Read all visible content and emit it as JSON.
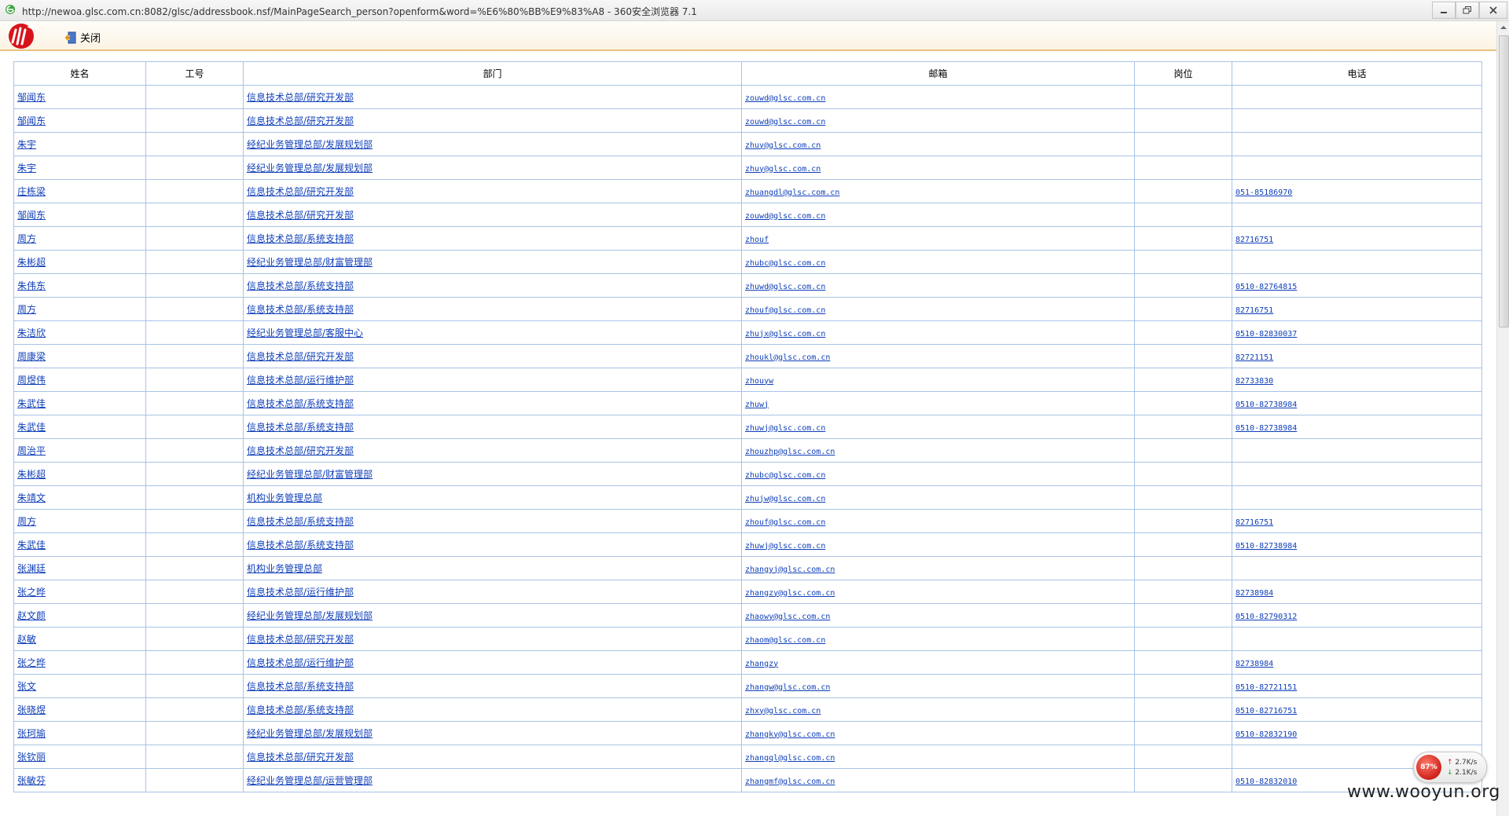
{
  "window": {
    "title": "http://newoa.glsc.com.cn:8082/glsc/addressbook.nsf/MainPageSearch_person?openform&word=%E6%80%BB%E9%83%A8 - 360安全浏览器 7.1"
  },
  "toolbar": {
    "close_label": "关闭"
  },
  "table": {
    "headers": [
      "姓名",
      "工号",
      "部门",
      "邮箱",
      "岗位",
      "电话"
    ],
    "rows": [
      {
        "name": "邹闻东",
        "id": "",
        "dept": "信息技术总部/研究开发部",
        "email": "zouwd@glsc.com.cn",
        "post": "",
        "phone": ""
      },
      {
        "name": "邹闻东",
        "id": "",
        "dept": "信息技术总部/研究开发部",
        "email": "zouwd@glsc.com.cn",
        "post": "",
        "phone": ""
      },
      {
        "name": "朱宇",
        "id": "",
        "dept": "经纪业务管理总部/发展规划部",
        "email": "zhuy@glsc.com.cn",
        "post": "",
        "phone": ""
      },
      {
        "name": "朱宇",
        "id": "",
        "dept": "经纪业务管理总部/发展规划部",
        "email": "zhuy@glsc.com.cn",
        "post": "",
        "phone": ""
      },
      {
        "name": "庄栋梁",
        "id": "",
        "dept": "信息技术总部/研究开发部",
        "email": "zhuangdl@glsc.com.cn",
        "post": "",
        "phone": "051-85186970"
      },
      {
        "name": "邹闻东",
        "id": "",
        "dept": "信息技术总部/研究开发部",
        "email": "zouwd@glsc.com.cn",
        "post": "",
        "phone": ""
      },
      {
        "name": "周方",
        "id": "",
        "dept": "信息技术总部/系统支持部",
        "email": "zhouf",
        "post": "",
        "phone": "82716751"
      },
      {
        "name": "朱彬超",
        "id": "",
        "dept": "经纪业务管理总部/财富管理部",
        "email": "zhubc@glsc.com.cn",
        "post": "",
        "phone": ""
      },
      {
        "name": "朱伟东",
        "id": "",
        "dept": "信息技术总部/系统支持部",
        "email": "zhuwd@glsc.com.cn",
        "post": "",
        "phone": "0510-82764815"
      },
      {
        "name": "周方",
        "id": "",
        "dept": "信息技术总部/系统支持部",
        "email": "zhouf@glsc.com.cn",
        "post": "",
        "phone": "82716751"
      },
      {
        "name": "朱洁欣",
        "id": "",
        "dept": "经纪业务管理总部/客服中心",
        "email": "zhujx@glsc.com.cn",
        "post": "",
        "phone": "0510-82830037"
      },
      {
        "name": "周康梁",
        "id": "",
        "dept": "信息技术总部/研究开发部",
        "email": "zhoukl@glsc.com.cn",
        "post": "",
        "phone": "82721151"
      },
      {
        "name": "周煜伟",
        "id": "",
        "dept": "信息技术总部/运行维护部",
        "email": "zhouyw",
        "post": "",
        "phone": "82733830"
      },
      {
        "name": "朱武佳",
        "id": "",
        "dept": "信息技术总部/系统支持部",
        "email": "zhuwj",
        "post": "",
        "phone": "0510-82738984"
      },
      {
        "name": "朱武佳",
        "id": "",
        "dept": "信息技术总部/系统支持部",
        "email": "zhuwj@glsc.com.cn",
        "post": "",
        "phone": "0510-82738984"
      },
      {
        "name": "周治平",
        "id": "",
        "dept": "信息技术总部/研究开发部",
        "email": "zhouzhp@glsc.com.cn",
        "post": "",
        "phone": ""
      },
      {
        "name": "朱彬超",
        "id": "",
        "dept": "经纪业务管理总部/财富管理部",
        "email": "zhubc@glsc.com.cn",
        "post": "",
        "phone": ""
      },
      {
        "name": "朱靖文",
        "id": "",
        "dept": "机构业务管理总部",
        "email": "zhujw@glsc.com.cn",
        "post": "",
        "phone": ""
      },
      {
        "name": "周方",
        "id": "",
        "dept": "信息技术总部/系统支持部",
        "email": "zhouf@glsc.com.cn",
        "post": "",
        "phone": "82716751"
      },
      {
        "name": "朱武佳",
        "id": "",
        "dept": "信息技术总部/系统支持部",
        "email": "zhuwj@glsc.com.cn",
        "post": "",
        "phone": "0510-82738984"
      },
      {
        "name": "张渊廷",
        "id": "",
        "dept": "机构业务管理总部",
        "email": "zhangyj@glsc.com.cn",
        "post": "",
        "phone": ""
      },
      {
        "name": "张之晔",
        "id": "",
        "dept": "信息技术总部/运行维护部",
        "email": "zhangzy@glsc.com.cn",
        "post": "",
        "phone": "82738984"
      },
      {
        "name": "赵文颜",
        "id": "",
        "dept": "经纪业务管理总部/发展规划部",
        "email": "zhaowy@glsc.com.cn",
        "post": "",
        "phone": "0510-82790312"
      },
      {
        "name": "赵敏",
        "id": "",
        "dept": "信息技术总部/研究开发部",
        "email": "zhaom@glsc.com.cn",
        "post": "",
        "phone": ""
      },
      {
        "name": "张之晔",
        "id": "",
        "dept": "信息技术总部/运行维护部",
        "email": "zhangzy",
        "post": "",
        "phone": "82738984"
      },
      {
        "name": "张文",
        "id": "",
        "dept": "信息技术总部/系统支持部",
        "email": "zhangw@glsc.com.cn",
        "post": "",
        "phone": "0510-82721151"
      },
      {
        "name": "张晓煜",
        "id": "",
        "dept": "信息技术总部/系统支持部",
        "email": "zhxy@glsc.com.cn",
        "post": "",
        "phone": "0510-82716751"
      },
      {
        "name": "张珂瑜",
        "id": "",
        "dept": "经纪业务管理总部/发展规划部",
        "email": "zhangky@glsc.com.cn",
        "post": "",
        "phone": "0510-82832190"
      },
      {
        "name": "张钦丽",
        "id": "",
        "dept": "信息技术总部/研究开发部",
        "email": "zhangql@glsc.com.cn",
        "post": "",
        "phone": ""
      },
      {
        "name": "张敏芬",
        "id": "",
        "dept": "经纪业务管理总部/运营管理部",
        "email": "zhangmf@glsc.com.cn",
        "post": "",
        "phone": "0510-82832010"
      }
    ]
  },
  "speed_widget": {
    "percent": "87%",
    "up": "2.7K/s",
    "down": "2.1K/s"
  },
  "watermark": "www.wooyun.org",
  "colors": {
    "link": "#0f3fb8",
    "border": "#a9c3e6",
    "toolbar_line": "#e9c27d"
  }
}
